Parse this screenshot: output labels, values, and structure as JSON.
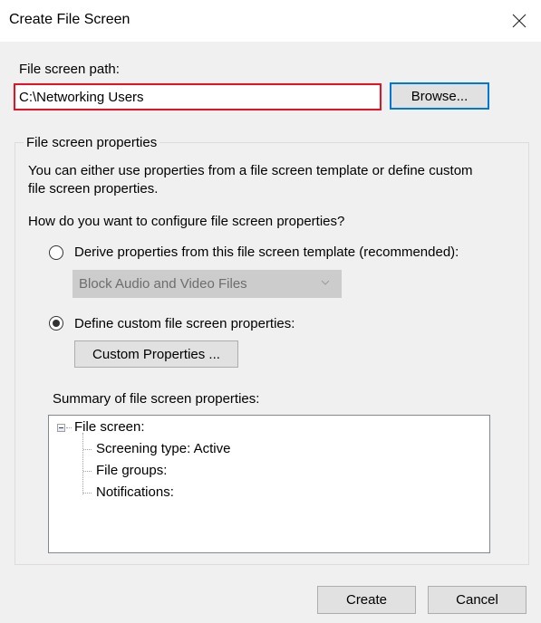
{
  "window": {
    "title": "Create File Screen",
    "close_icon": "close-icon"
  },
  "path": {
    "label": "File screen path:",
    "value": "C:\\Networking Users",
    "browse_label": "Browse...",
    "error_border_color": "#e81123"
  },
  "properties": {
    "group_label": "File screen properties",
    "description": "You can either use properties from a file screen template or define custom file screen properties.",
    "description_line1": "You can either use properties from a file screen template or define custom",
    "description_line2": "file screen properties.",
    "question": "How do you want to configure file screen properties?",
    "options": [
      {
        "label": "Derive properties from this file screen template (recommended):",
        "selected": false
      },
      {
        "label": "Define custom file screen properties:",
        "selected": true
      }
    ],
    "template_dropdown": {
      "selected": "Block Audio and Video Files",
      "enabled": false
    },
    "custom_properties_label": "Custom Properties ...",
    "summary_label": "Summary of file screen properties:",
    "summary_tree": {
      "root": "File screen:",
      "expanded": true,
      "children": [
        "Screening type: Active",
        "File groups:",
        "Notifications:"
      ]
    }
  },
  "footer": {
    "create_label": "Create",
    "cancel_label": "Cancel"
  },
  "colors": {
    "focus_accent": "#0078d7",
    "dialog_background": "#f0f0f0"
  }
}
